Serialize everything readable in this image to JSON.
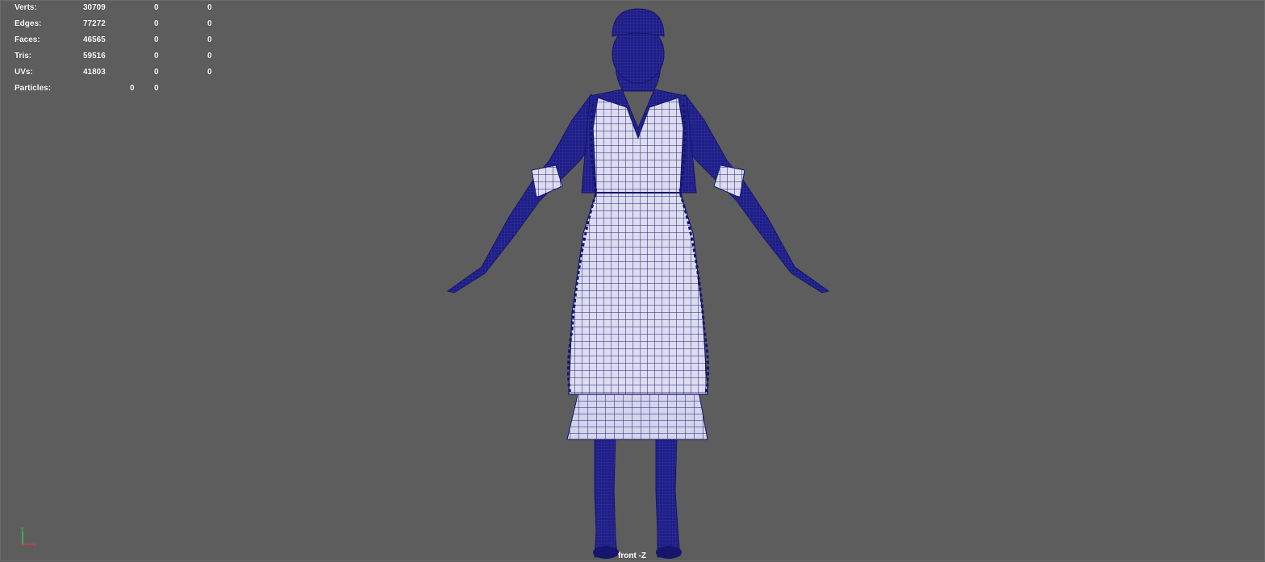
{
  "hud": {
    "rows": [
      {
        "label": "Verts:",
        "total": "30709",
        "selected": "0",
        "components": "0"
      },
      {
        "label": "Edges:",
        "total": "77272",
        "selected": "0",
        "components": "0"
      },
      {
        "label": "Faces:",
        "total": "46565",
        "selected": "0",
        "components": "0"
      },
      {
        "label": "Tris:",
        "total": "59516",
        "selected": "0",
        "components": "0"
      },
      {
        "label": "UVs:",
        "total": "41803",
        "selected": "0",
        "components": "0"
      }
    ],
    "particles": {
      "label": "Particles:",
      "total": "0",
      "selected": "0"
    }
  },
  "camera": {
    "label": "front -Z"
  },
  "axis": {
    "y_label": "y",
    "x_label": "x"
  },
  "colors": {
    "background": "#5d5d5d",
    "wireframe": "#1c1c82",
    "mesh_fill": "#d8d8ec",
    "axis_x": "#e23a3a",
    "axis_y": "#3ad14a"
  },
  "scene": {
    "object": "maid-character-wireframe",
    "view": "front orthographic"
  }
}
